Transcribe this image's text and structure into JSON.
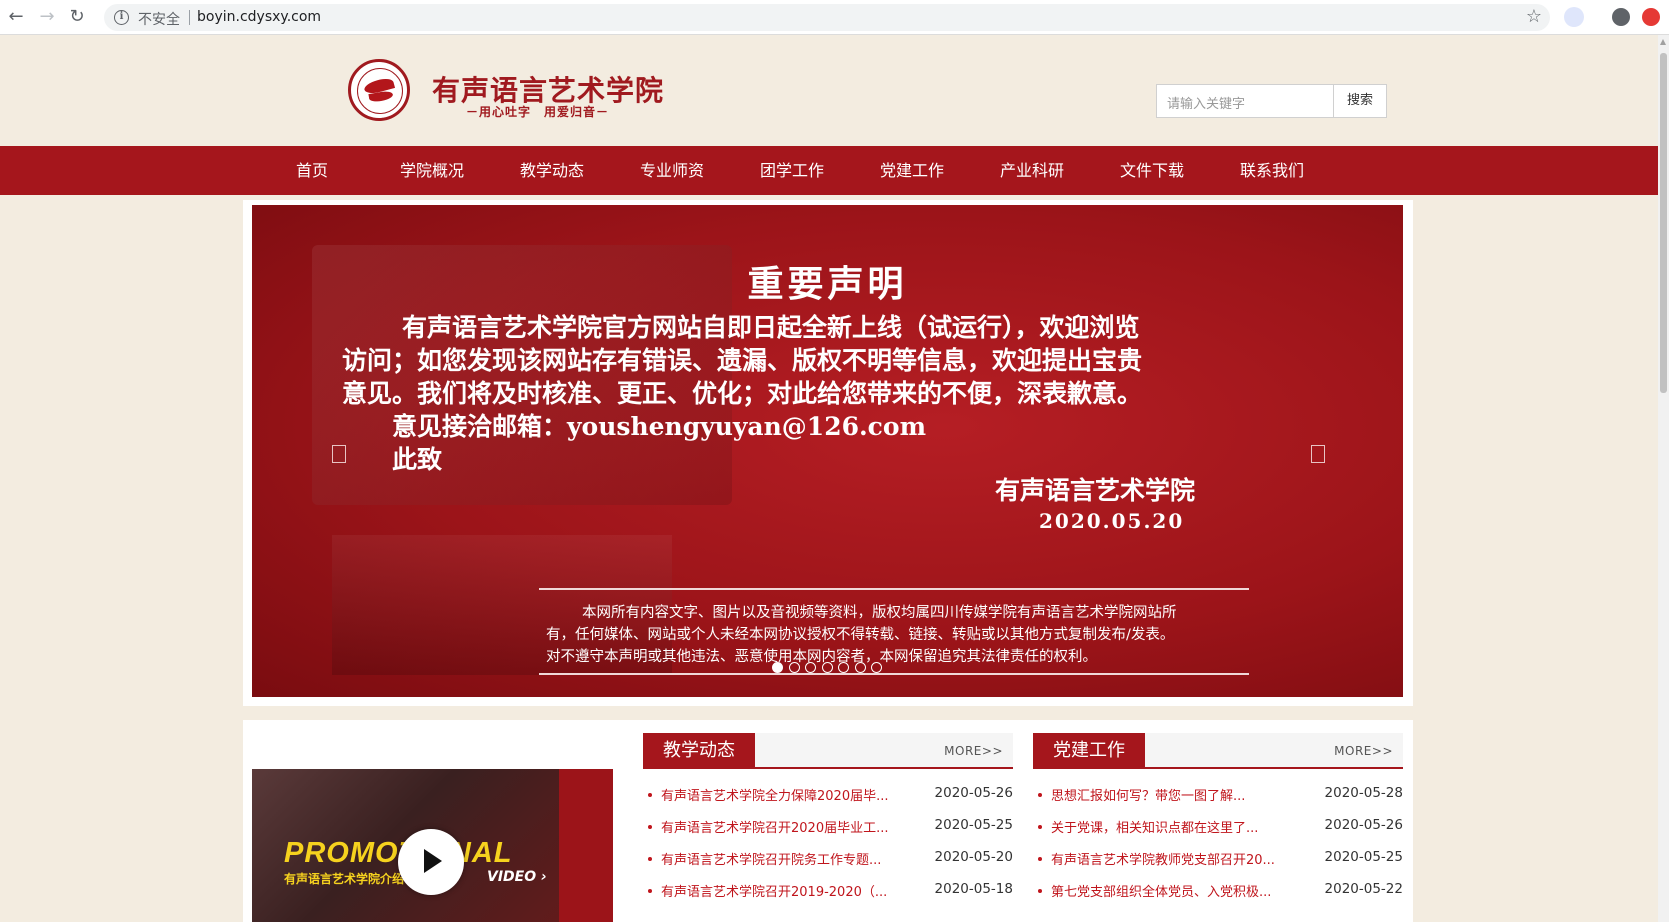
{
  "browser": {
    "back_icon": "arrow-left-icon",
    "forward_icon": "arrow-right-icon",
    "reload_icon": "reload-icon",
    "security_label": "不安全",
    "url": "boyin.cdysxy.com",
    "bookmark_icon": "star-icon",
    "extension_icons": [
      "bird-extension-icon",
      "account-icon",
      "red-extension-icon"
    ]
  },
  "header": {
    "logo_icon": "school-seal-logo",
    "title": "有声语言艺术学院",
    "slogan": "－用心吐字　用爱归音－",
    "search_placeholder": "请输入关键字",
    "search_button": "搜索"
  },
  "nav": {
    "items": [
      "首页",
      "学院概况",
      "教学动态",
      "专业师资",
      "团学工作",
      "党建工作",
      "产业科研",
      "文件下载",
      "联系我们"
    ]
  },
  "banner": {
    "title": "重要声明",
    "lines": [
      "有声语言艺术学院官方网站自即日起全新上线（试运行），欢迎浏览",
      "访问；如您发现该网站存有错误、遗漏、版权不明等信息，欢迎提出宝贵",
      "意见。我们将及时核准、更正、优化；对此给您带来的不便，深表歉意。",
      "意见接洽邮箱：youshengyuyan@126.com",
      "此致"
    ],
    "signature": "有声语言艺术学院",
    "date": "2020.05.20",
    "fine_print": [
      "本网所有内容文字、图片以及音视频等资料，版权均属四川传媒学院有声语言艺术学院网站所",
      "有，任何媒体、网站或个人未经本网协议授权不得转载、链接、转贴或以其他方式复制发布/发表。",
      "对不遵守本声明或其他违法、恶意使用本网内容者，本网保留追究其法律责任的权利。"
    ],
    "prev_icon": "prev-arrow-icon",
    "next_icon": "next-arrow-icon",
    "slide_count": 7,
    "active_slide": 1
  },
  "video": {
    "headline": "PROMOTIONAL",
    "subtitle": "有声语言艺术学院介绍",
    "tag": "VIDEO ›",
    "play_icon": "play-icon"
  },
  "panels": [
    {
      "title": "教学动态",
      "more": "MORE>>",
      "items": [
        {
          "title": "有声语言艺术学院全力保障2020届毕...",
          "date": "2020-05-26"
        },
        {
          "title": "有声语言艺术学院召开2020届毕业工...",
          "date": "2020-05-25"
        },
        {
          "title": "有声语言艺术学院召开院务工作专题...",
          "date": "2020-05-20"
        },
        {
          "title": "有声语言艺术学院召开2019-2020（...",
          "date": "2020-05-18"
        }
      ]
    },
    {
      "title": "党建工作",
      "more": "MORE>>",
      "items": [
        {
          "title": "思想汇报如何写？带您一图了解...",
          "date": "2020-05-28"
        },
        {
          "title": "关于党课，相关知识点都在这里了...",
          "date": "2020-05-26"
        },
        {
          "title": "有声语言艺术学院教师党支部召开20...",
          "date": "2020-05-25"
        },
        {
          "title": "第七党支部组织全体党员、入党积极...",
          "date": "2020-05-22"
        }
      ]
    }
  ],
  "colors": {
    "brand_red": "#a5161c",
    "link_red": "#c0151c",
    "page_bg": "#f3ece0",
    "promo_yellow": "#f6d21e"
  }
}
